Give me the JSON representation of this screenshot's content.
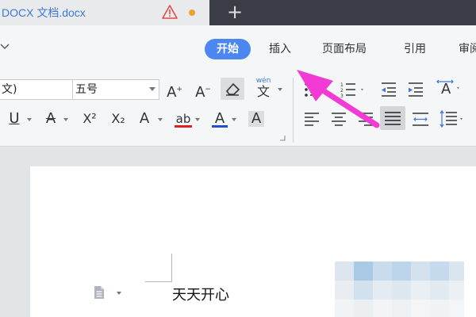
{
  "tab": {
    "title": "DOCX 文档.docx",
    "new_tab_label": "+"
  },
  "menu": {
    "items": [
      "开始",
      "插入",
      "页面布局",
      "引用",
      "审阅"
    ]
  },
  "ribbon": {
    "font_name": "文)",
    "font_size": "五号",
    "grow_font": "A",
    "shrink_font": "A",
    "phonetic": "wén",
    "phonetic_char": "文",
    "underline": "U",
    "strike": "A",
    "superscript": "X²",
    "subscript": "X₂",
    "text_effect": "A",
    "highlight": "ab",
    "font_color": "A",
    "char_shading": "A",
    "text_direction": "A"
  },
  "document": {
    "text": "天天开心"
  },
  "colors": {
    "accent": "#4c86f0",
    "tab_bar": "#3b3e46",
    "highlight_bar": "#e02020",
    "font_color_bar": "#2050d0",
    "arrow": "#f23bd4"
  },
  "icons": [
    "warning-icon",
    "unsaved-dot-icon",
    "chevron-down-icon",
    "eraser-icon",
    "bullet-list-icon",
    "numbered-list-icon",
    "decrease-indent-icon",
    "increase-indent-icon",
    "align-left-icon",
    "align-center-icon",
    "align-right-icon",
    "justify-icon",
    "distributed-icon",
    "line-spacing-icon",
    "document-icon"
  ]
}
